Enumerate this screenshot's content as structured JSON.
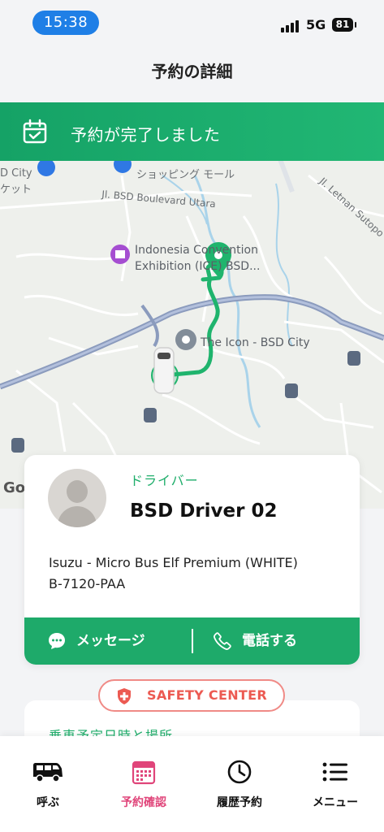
{
  "status_bar": {
    "time": "15:38",
    "network": "5G",
    "battery": "81"
  },
  "header": {
    "title": "予約の詳細"
  },
  "banner": {
    "text": "予約が完了しました"
  },
  "map": {
    "labels": {
      "bsd_city": "D City",
      "market": "ケット",
      "shopping": "ショッピング モール",
      "boulevard": "Jl. BSD Boulevard Utara",
      "letnan": "Jl. Letnan Sutopo",
      "ice_line1": "Indonesia Convention",
      "ice_line2": "Exhibition (ICE) BSD...",
      "the_icon": "The Icon - BSD City",
      "google": "Go"
    }
  },
  "driver": {
    "role": "ドライバー",
    "name": "BSD Driver 02",
    "vehicle": "Isuzu - Micro Bus Elf Premium (WHITE)",
    "plate": "B-7120-PAA",
    "message_label": "メッセージ",
    "call_label": "電話する"
  },
  "safety": {
    "label": "SAFETY CENTER"
  },
  "next_section": {
    "title": "乗車予定日時と場所"
  },
  "tabs": [
    {
      "label": "呼ぶ",
      "icon": "bus-icon"
    },
    {
      "label": "予約確認",
      "icon": "calendar-icon"
    },
    {
      "label": "履歴予約",
      "icon": "clock-icon"
    },
    {
      "label": "メニュー",
      "icon": "list-menu-icon"
    }
  ],
  "colors": {
    "brand_green": "#1eaa6a",
    "accent_pink": "#e0457a",
    "time_pill": "#1f7fe6",
    "safety_red": "#ec5a52"
  }
}
